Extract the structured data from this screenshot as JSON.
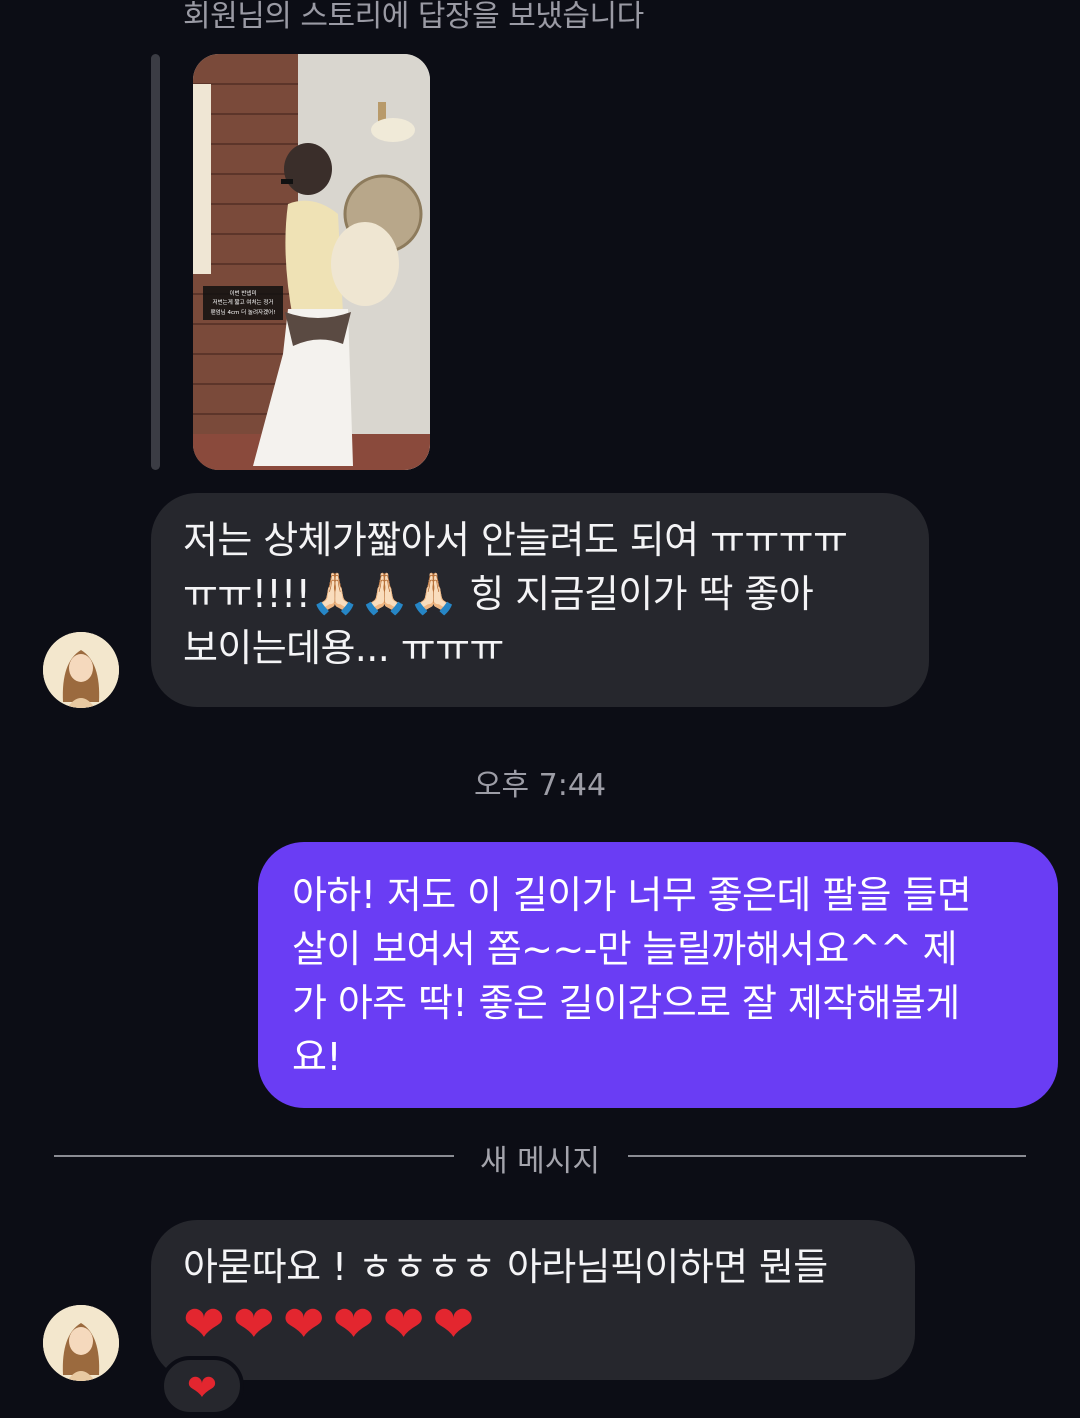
{
  "story_reply": {
    "caption": "회원님의 스토리에 답장을 보냈습니다",
    "thumbnail_text": [
      "이번 반넵미",
      "저번는게 짧고 여처는 정거",
      "팬엄님 4cm 더 놀려자겠어!"
    ]
  },
  "messages": {
    "incoming_1": {
      "line1": "저는 상체가짧아서 안늘려도 되여 ㅠㅠㅠㅠ",
      "line2_a": "ㅠㅠ!!!!",
      "line2_emoji": "🙏🏻🙏🏻🙏🏻",
      "line2_b": " 힝 지금길이가 딱 좋아",
      "line3": "보이는데용... ㅠㅠㅠ"
    },
    "timestamp": "오후 7:44",
    "outgoing_1": {
      "line1": "아하! 저도 이 길이가 너무 좋은데 팔을 들면",
      "line2": "살이 보여서 쫌~~-만 늘릴까해서요^^ 제",
      "line3": "가 아주 딱! 좋은 길이감으로 잘 제작해볼게",
      "line4": "요!"
    },
    "new_messages_divider": "새 메시지",
    "incoming_2": {
      "line1": "아묻따요 ! ㅎㅎㅎㅎ 아라님픽이하면 뭔들",
      "hearts": "❤❤❤❤❤❤"
    },
    "reaction": "❤"
  },
  "colors": {
    "background": "#0c0d15",
    "incoming_bubble": "#26272d",
    "outgoing_bubble": "#6a3df4",
    "heart": "#e3262f"
  }
}
